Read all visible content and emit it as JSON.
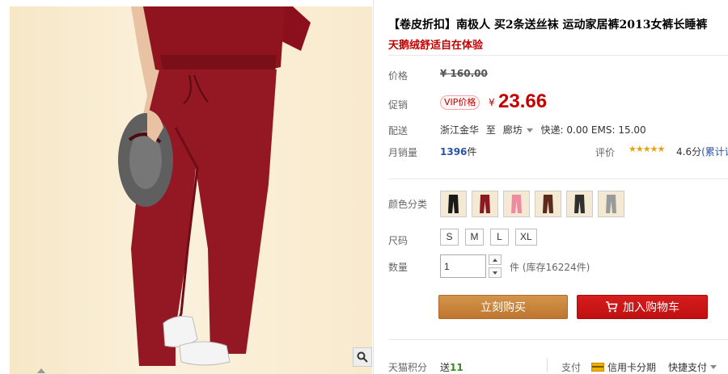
{
  "product": {
    "title": "【卷皮折扣】南极人 买2条送丝袜 运动家居裤2013女裤长睡裤",
    "subtitle": "天鹅绒舒适自在体验"
  },
  "price": {
    "label": "价格",
    "original": "¥ 160.00",
    "promo_label": "促销",
    "vip_badge": "VIP价格",
    "currency": "¥",
    "current": "23.66"
  },
  "shipping": {
    "label": "配送",
    "from": "浙江金华",
    "to_word": "至",
    "destination": "廊坊",
    "fees": "快递: 0.00 EMS: 15.00"
  },
  "sales": {
    "label": "月销量",
    "count": "1396",
    "unit": "件",
    "rating_label": "评价",
    "stars": "★★★★★",
    "score": "4.6分",
    "reviews_link": "(累计评"
  },
  "colors": {
    "label": "颜色分类",
    "swatch_colors": [
      "#1a1a1a",
      "#8a1a22",
      "#f08aa0",
      "#5a2a1c",
      "#2f2f2f",
      "#9a9a9a"
    ]
  },
  "sizes": {
    "label": "尺码",
    "options": [
      "S",
      "M",
      "L",
      "XL"
    ]
  },
  "quantity": {
    "label": "数量",
    "value": "1",
    "stock": "件 (库存16224件)"
  },
  "actions": {
    "buy_now": "立刻购买",
    "add_to_cart": "加入购物车"
  },
  "footer": {
    "points_label": "天猫积分",
    "points_prefix": "送",
    "points_value": "11",
    "pay_label": "支付",
    "pay_card": "信用卡分期",
    "pay_quick": "快捷支付"
  },
  "icons": {
    "zoom": "magnifier-icon",
    "cart": "cart-icon",
    "card": "credit-card-icon"
  },
  "theme": {
    "accent_red": "#c40000",
    "buy_orange": "#c9843e",
    "cart_red": "#cf1414",
    "link_blue": "#2953a6"
  }
}
